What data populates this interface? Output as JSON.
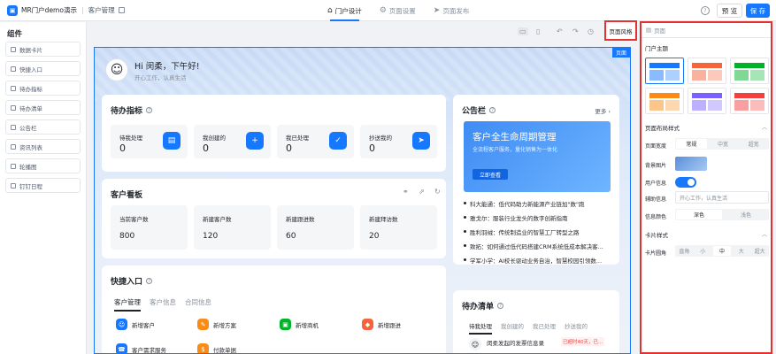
{
  "header": {
    "app_name": "MR门户demo演示",
    "breadcrumb": "客户管理",
    "modes": [
      {
        "label": "门户设计",
        "icon": "⌂",
        "active": true
      },
      {
        "label": "页面设置",
        "icon": "⚙",
        "active": false
      },
      {
        "label": "页面发布",
        "icon": "➤",
        "active": false
      }
    ],
    "help": "?",
    "preview": "预 览",
    "save": "保 存"
  },
  "components": {
    "title": "组件",
    "items": [
      "数据卡片",
      "快捷入口",
      "待办指标",
      "待办清单",
      "公告栏",
      "资讯列表",
      "轮播图",
      "钉钉日程"
    ]
  },
  "toolbar": {
    "style_button": "页面风格"
  },
  "canvas": {
    "page_tag": "页面",
    "greeting": "Hi 闵柔，下午好!",
    "subtitle": "开心工作，认真生活",
    "todo": {
      "title": "待办指标",
      "items": [
        {
          "label": "待我处理",
          "value": "0",
          "icon": "▤"
        },
        {
          "label": "我创建的",
          "value": "0",
          "icon": "+"
        },
        {
          "label": "我已处理",
          "value": "0",
          "icon": "✓"
        },
        {
          "label": "抄送我的",
          "value": "0",
          "icon": "➤"
        }
      ]
    },
    "customer": {
      "title": "客户看板",
      "items": [
        {
          "label": "当前客户数",
          "value": "800"
        },
        {
          "label": "新建客户数",
          "value": "120"
        },
        {
          "label": "新建跟进数",
          "value": "60"
        },
        {
          "label": "新建拜访数",
          "value": "20"
        }
      ]
    },
    "quick": {
      "title": "快捷入口",
      "tabs": [
        "客户管理",
        "客户信息",
        "合同信息"
      ],
      "items": [
        {
          "label": "新增客户",
          "color": "#1677ff",
          "icon": "☺"
        },
        {
          "label": "新增方案",
          "color": "#fa8c16",
          "icon": "✎"
        },
        {
          "label": "新增商机",
          "color": "#00b42a",
          "icon": "▣"
        },
        {
          "label": "新增跟进",
          "color": "#f5643c",
          "icon": "◆"
        },
        {
          "label": "客户需求服务",
          "color": "#1677ff",
          "icon": "☎"
        },
        {
          "label": "付款单据",
          "color": "#fa8c16",
          "icon": "$"
        }
      ]
    },
    "notice": {
      "title": "公告栏",
      "more": "更多",
      "banner_title": "客户全生命周期管理",
      "banner_sub": "全流程客户服务，量化销售为一体化",
      "banner_button": "立即查看",
      "news": [
        "科大能通：低代码助力新能源产业链加\"数\"跑",
        "雅戈尔：服装行业龙头的数字创新指南",
        "胜利羽绒：传统制造业的智慧工厂转型之路",
        "致拓：如何通过低代码搭建CRM系统低成本解决客...",
        "学军小学：AI校长驱动业务自治，智慧校园引领数..."
      ]
    },
    "todolist": {
      "title": "待办清单",
      "tabs": [
        "待我处理",
        "我创建的",
        "我已处理",
        "抄送我的"
      ],
      "item_title": "闵柔发起的发票信息录",
      "item_badge": "已超时40天，已..."
    }
  },
  "right_panel": {
    "header": "页面",
    "portal_theme": "门户主题",
    "theme_colors": [
      "#1677ff",
      "#f5643c",
      "#00b42a",
      "#fa8c16",
      "#7b61ff",
      "#f53f3f"
    ],
    "layout_style": "页面布局样式",
    "width_label": "页面宽度",
    "width_options": [
      "常规",
      "中宽",
      "超宽"
    ],
    "bg_image_label": "背景图片",
    "user_info_label": "用户信息",
    "aux_info_label": "辅助信息",
    "aux_info_value": "开心工作，认真生活",
    "info_color_label": "信息颜色",
    "info_color_options": [
      "深色",
      "浅色"
    ],
    "card_style": "卡片样式",
    "radius_label": "卡片圆角",
    "radius_options": [
      "直角",
      "小",
      "中",
      "大",
      "超大"
    ]
  }
}
